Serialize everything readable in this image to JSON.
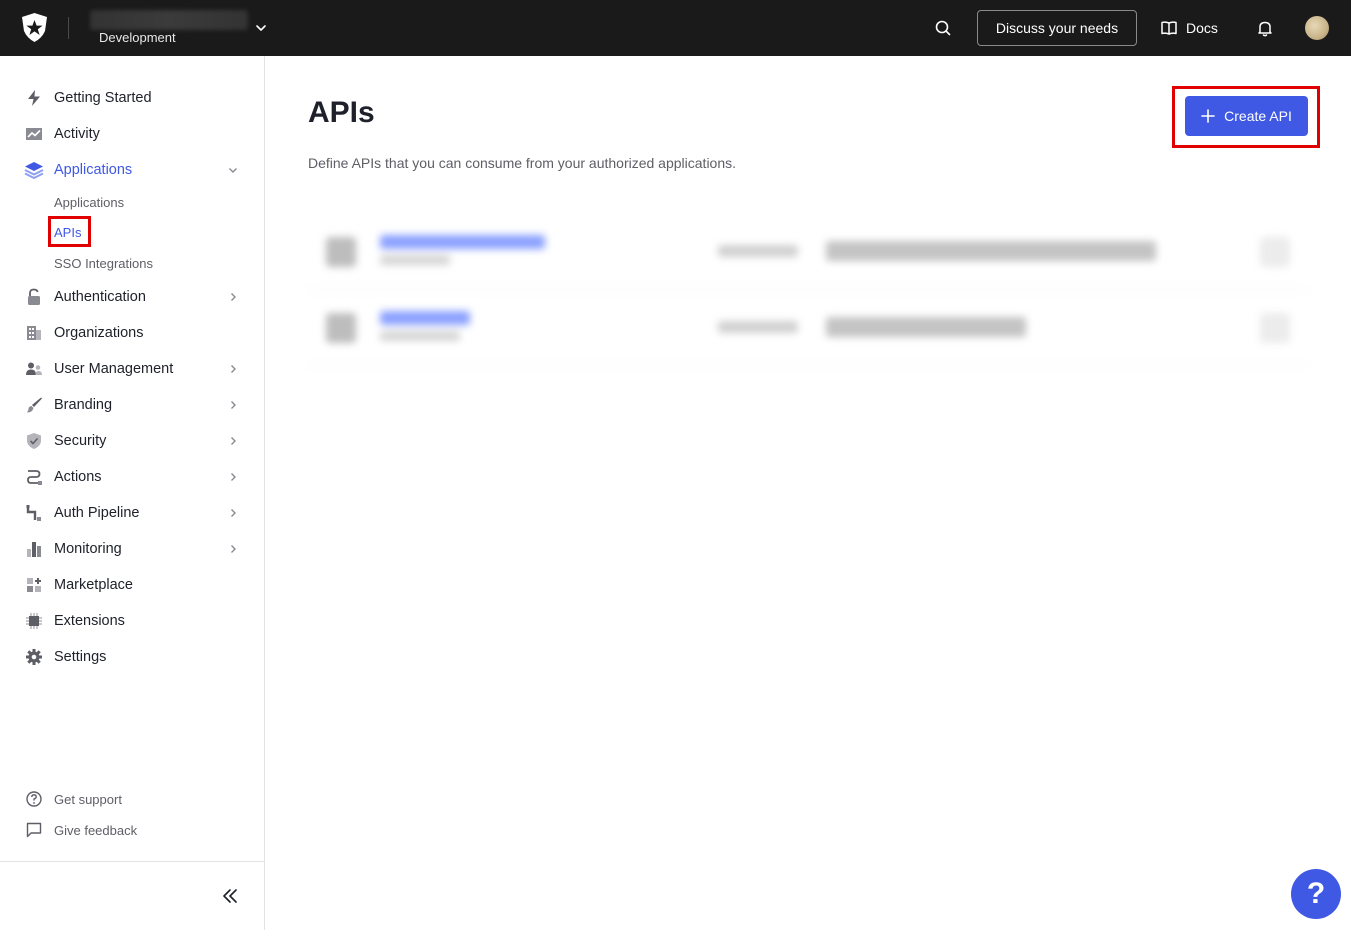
{
  "header": {
    "environment": "Development",
    "discuss_label": "Discuss your needs",
    "docs_label": "Docs"
  },
  "sidebar": {
    "items": [
      {
        "label": "Getting Started",
        "icon": "lightning-icon"
      },
      {
        "label": "Activity",
        "icon": "activity-chart-icon"
      },
      {
        "label": "Applications",
        "icon": "layers-icon",
        "expanded": true,
        "children": [
          {
            "label": "Applications"
          },
          {
            "label": "APIs",
            "active": true
          },
          {
            "label": "SSO Integrations"
          }
        ]
      },
      {
        "label": "Authentication",
        "icon": "lock-icon"
      },
      {
        "label": "Organizations",
        "icon": "building-icon"
      },
      {
        "label": "User Management",
        "icon": "users-icon"
      },
      {
        "label": "Branding",
        "icon": "brush-icon"
      },
      {
        "label": "Security",
        "icon": "shield-icon"
      },
      {
        "label": "Actions",
        "icon": "actions-flow-icon"
      },
      {
        "label": "Auth Pipeline",
        "icon": "pipeline-icon"
      },
      {
        "label": "Monitoring",
        "icon": "bar-chart-icon"
      },
      {
        "label": "Marketplace",
        "icon": "grid-plus-icon"
      },
      {
        "label": "Extensions",
        "icon": "chip-icon"
      },
      {
        "label": "Settings",
        "icon": "gear-icon"
      }
    ],
    "footer": [
      {
        "label": "Get support",
        "icon": "help-circle-icon"
      },
      {
        "label": "Give feedback",
        "icon": "chat-bubble-icon"
      }
    ]
  },
  "main": {
    "title": "APIs",
    "description": "Define APIs that you can consume from your authorized applications.",
    "create_label": "Create API"
  },
  "help_label": "?",
  "colors": {
    "accent": "#3f59e4",
    "topbar": "#1a1a1a",
    "highlight": "#e00000"
  }
}
